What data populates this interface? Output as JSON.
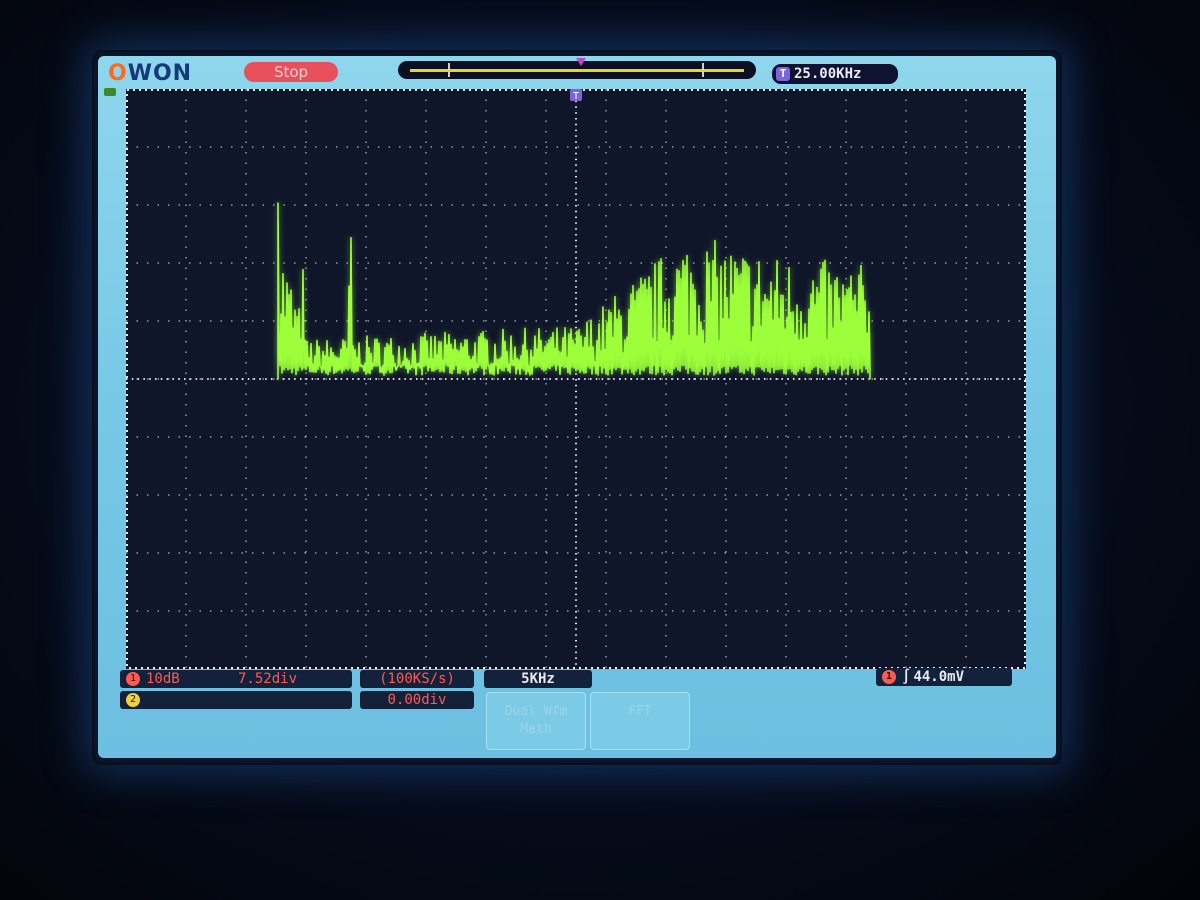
{
  "header": {
    "brand_o": "O",
    "brand_rest": "WON",
    "run_state": "Stop",
    "time_badge": "T",
    "freq_readout": "25.00KHz"
  },
  "channel1": {
    "number": "1",
    "scale": "10dB",
    "position": "7.52div"
  },
  "channel2": {
    "number": "2"
  },
  "math": {
    "sample_rate": "(100KS/s)",
    "offset": "0.00div"
  },
  "horizontal": {
    "scale": "5KHz"
  },
  "trigger": {
    "source": "1",
    "level": "44.0mV"
  },
  "softkeys": [
    {
      "label_line1": "Dual Wfm",
      "label_line2": "Math"
    },
    {
      "label_line1": "FFT",
      "label_line2": ""
    }
  ],
  "colors": {
    "trace": "#9cff3a",
    "ch1": "#ff5a52",
    "ch2": "#f0d040",
    "screen_bg": "#10162a",
    "frame": "#7ccbe6"
  },
  "icons": {
    "trigger_edge": "rising-edge-icon",
    "trigger_position": "trigger-marker-icon"
  }
}
